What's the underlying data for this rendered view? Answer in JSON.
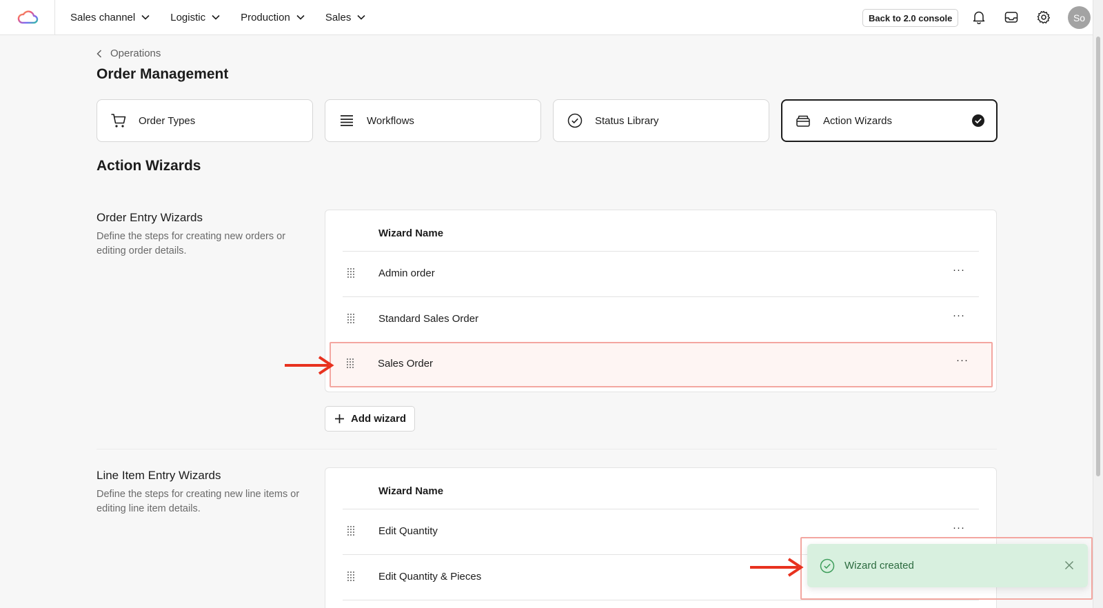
{
  "app": {
    "logo_icon": "cloud-logo-icon"
  },
  "nav": {
    "items": [
      {
        "label": "Sales channel",
        "icon": "chevron-down-icon"
      },
      {
        "label": "Logistic",
        "icon": "chevron-down-icon"
      },
      {
        "label": "Production",
        "icon": "chevron-down-icon"
      },
      {
        "label": "Sales",
        "icon": "chevron-down-icon"
      }
    ],
    "back_button": "Back to 2.0 console",
    "icons": [
      "bell-icon",
      "inbox-icon",
      "gear-icon"
    ],
    "avatar_initials": "So"
  },
  "breadcrumb": {
    "parent": "Operations"
  },
  "page": {
    "title": "Order Management",
    "section_title": "Action Wizards"
  },
  "tabs": [
    {
      "label": "Order Types",
      "icon": "cart-icon",
      "active": false
    },
    {
      "label": "Workflows",
      "icon": "list-icon",
      "active": false
    },
    {
      "label": "Status Library",
      "icon": "check-circle-icon",
      "active": false
    },
    {
      "label": "Action Wizards",
      "icon": "stack-icon",
      "active": true
    }
  ],
  "order_entry": {
    "title": "Order Entry Wizards",
    "description": "Define the steps for creating new orders or editing order details.",
    "column_header": "Wizard Name",
    "rows": [
      {
        "name": "Admin order"
      },
      {
        "name": "Standard Sales Order"
      },
      {
        "name": "Sales Order"
      }
    ],
    "more_label": "···",
    "add_button": "Add wizard"
  },
  "line_item_entry": {
    "title": "Line Item Entry Wizards",
    "description": "Define the steps for creating new line items or editing line item details.",
    "column_header": "Wizard Name",
    "rows": [
      {
        "name": "Edit Quantity"
      },
      {
        "name": "Edit Quantity & Pieces"
      }
    ],
    "more_label": "···"
  },
  "toast": {
    "message": "Wizard created",
    "icon": "check-circle-icon",
    "close_icon": "close-icon"
  },
  "colors": {
    "accent_dark": "#1c1c1c",
    "highlight_border": "#f3a6a0",
    "arrow": "#e8321f",
    "toast_bg": "#d8f0df",
    "toast_text": "#2c6b3f"
  }
}
